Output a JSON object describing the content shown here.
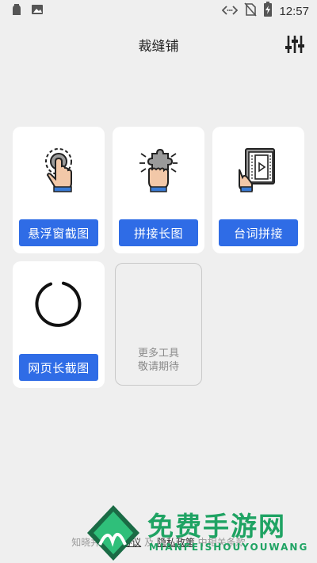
{
  "status_bar": {
    "time": "12:57",
    "icons": [
      "app-notification-icon",
      "image-icon",
      "code-icon",
      "no-sim-icon",
      "battery-charging-icon"
    ]
  },
  "header": {
    "title": "裁缝铺",
    "filter_icon": "sliders-icon"
  },
  "tools": [
    {
      "label": "悬浮窗截图",
      "icon": "tap-gesture-icon"
    },
    {
      "label": "拼接长图",
      "icon": "puzzle-hand-icon"
    },
    {
      "label": "台词拼接",
      "icon": "film-book-icon"
    },
    {
      "label": "网页长截图",
      "icon": "loading-circle-icon"
    }
  ],
  "more_tools": {
    "line1": "更多工具",
    "line2": "敬请期待"
  },
  "footer": {
    "prefix": "知晓并同意",
    "agreement": "协议",
    "and": "及",
    "privacy": "隐私政策",
    "suffix": "中相关条款"
  },
  "watermark": {
    "text": "免费手游网",
    "subtext": "MIANFEISHOUYOUWANG"
  },
  "colors": {
    "button": "#2f6ce6",
    "background": "#efefef",
    "watermark": "#1fa363"
  }
}
